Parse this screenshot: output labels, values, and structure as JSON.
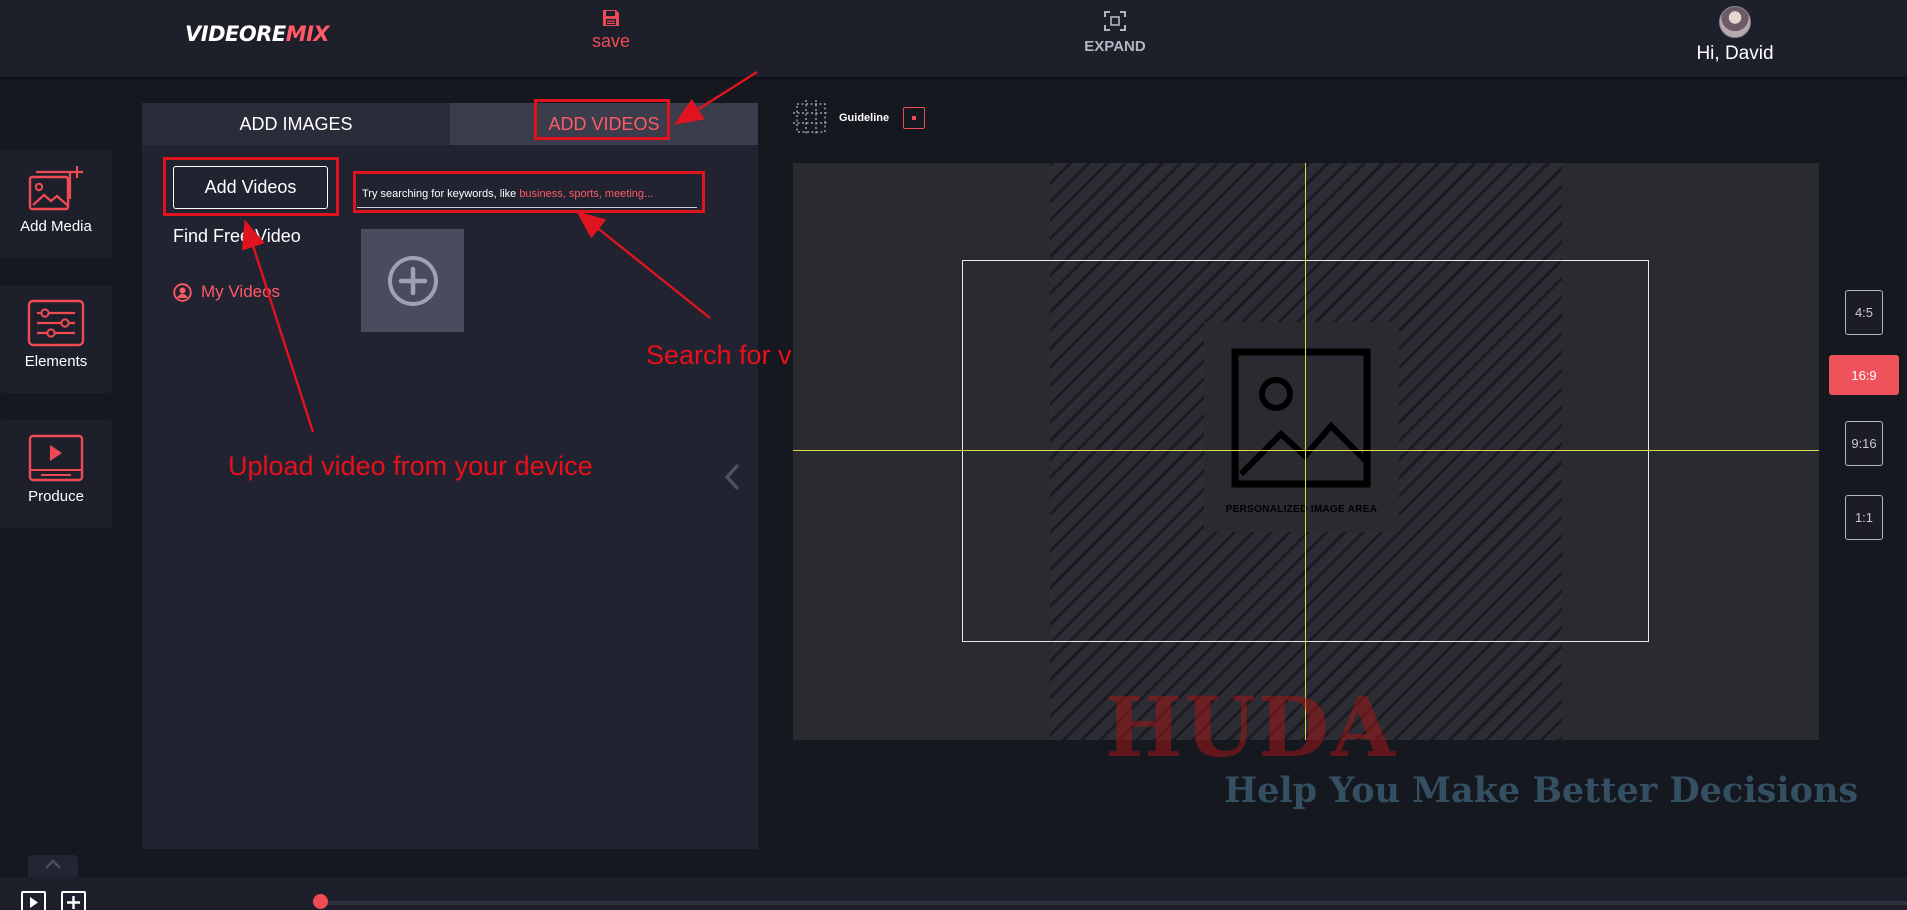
{
  "header": {
    "logo_main": "VIDEORE",
    "logo_accent": "MIX",
    "save_label": "save",
    "expand_label": "EXPAND",
    "greeting": "Hi, David"
  },
  "sidebar": {
    "items": [
      {
        "label": "Add Media",
        "icon": "add-media-icon"
      },
      {
        "label": "Elements",
        "icon": "sliders-icon"
      },
      {
        "label": "Produce",
        "icon": "video-play-icon"
      }
    ]
  },
  "panel": {
    "tabs": [
      {
        "label": "ADD IMAGES",
        "active": false
      },
      {
        "label": "ADD VIDEOS",
        "active": true
      }
    ],
    "add_videos_label": "Add Videos",
    "find_free_label": "Find Free Video",
    "my_videos_label": "My Videos",
    "search": {
      "placeholder_prefix": "Try searching for keywords, like ",
      "placeholder_keywords": "business, sports, meeting..."
    }
  },
  "annotations": {
    "upload": "Upload video from your device",
    "search": "Search for video online"
  },
  "canvas": {
    "guideline_label": "Guideline",
    "image_area_caption": "PERSONALIZED IMAGE AREA"
  },
  "ratios": [
    {
      "label": "4:5",
      "active": false
    },
    {
      "label": "16:9",
      "active": true
    },
    {
      "label": "9:16",
      "active": false
    },
    {
      "label": "1:1",
      "active": false
    }
  ],
  "watermark": {
    "brand": "HUDA",
    "tagline": "Help You Make Better Decisions"
  },
  "colors": {
    "accent": "#ef4b55",
    "annotation": "#e0141e",
    "guide": "#e0d84a",
    "background": "#161820"
  }
}
